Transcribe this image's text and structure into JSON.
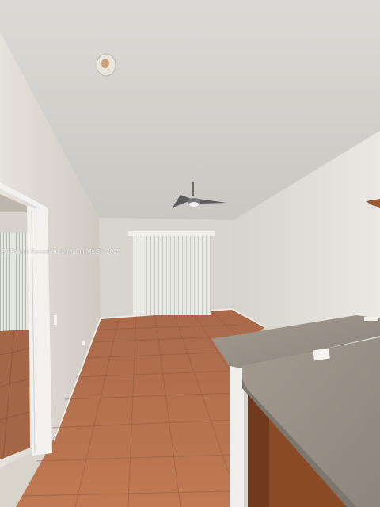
{
  "photo": {
    "scene": "empty living room with tile floor",
    "watermark_text": "All Rights Reserved © Miami MLS® 2025"
  },
  "colors": {
    "ceiling": "#d2d0cb",
    "left_wall": "#dcd7d0",
    "right_wall": "#e2dfd9",
    "back_wall": "#d9d6cf",
    "floor_tile": "#b9734f",
    "grout": "#8e5a3f",
    "counter": "#9c948a",
    "cabinet": "#8a4a26"
  }
}
